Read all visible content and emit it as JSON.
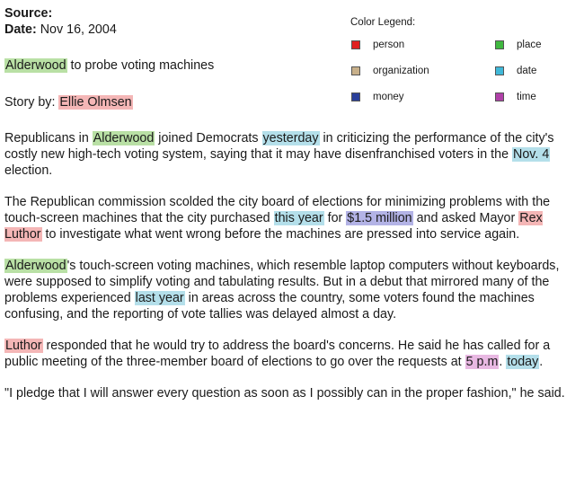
{
  "meta": {
    "source_label": "Source:",
    "date_label": "Date:",
    "date_value": "Nov 16, 2004"
  },
  "headline": {
    "place": "Alderwood",
    "rest": " to probe voting machines"
  },
  "byline": {
    "label": "Story by: ",
    "author": "Ellie Olmsen"
  },
  "legend": {
    "title": "Color Legend:",
    "items": [
      {
        "label": "person",
        "color": "#e02020"
      },
      {
        "label": "place",
        "color": "#40b840"
      },
      {
        "label": "organization",
        "color": "#c8b08a"
      },
      {
        "label": "date",
        "color": "#40b8d8"
      },
      {
        "label": "money",
        "color": "#2a3f9a"
      },
      {
        "label": "time",
        "color": "#b040a8"
      }
    ]
  },
  "article": {
    "p1": {
      "a": "Republicans in ",
      "place": "Alderwood",
      "b": " joined Democrats ",
      "date": "yesterday",
      "c": " in criticizing the performance of the city's costly new high-tech voting system, saying that it may have disenfranchised voters in the ",
      "date2": "Nov. 4",
      "d": " election."
    },
    "p2": {
      "a": "The Republican commission scolded the city board of elections for minimizing problems with the touch-screen machines that the city purchased ",
      "date": "this year",
      "b": " for ",
      "money": "$1.5 million",
      "c": " and asked Mayor ",
      "person": "Rex Luthor",
      "d": " to investigate what went wrong before the machines are pressed into service again."
    },
    "p3": {
      "place": "Alderwood",
      "a": "'s touch-screen voting machines, which resemble laptop computers without keyboards, were supposed to simplify voting and tabulating results. But in a debut that mirrored many of the problems experienced ",
      "date": "last year",
      "b": " in areas across the country, some voters found the machines confusing, and the reporting of vote tallies was delayed almost a day."
    },
    "p4": {
      "person": "Luthor",
      "a": " responded that he would try to address the board's concerns. He said he has called for a public meeting of the three-member board of elections to go over the requests at ",
      "time": "5 p.m",
      "b": ". ",
      "date": "today",
      "c": "."
    },
    "p5": {
      "a": "\"I pledge that I will answer every question as soon as I possibly can in the proper fashion,\" he said."
    }
  }
}
